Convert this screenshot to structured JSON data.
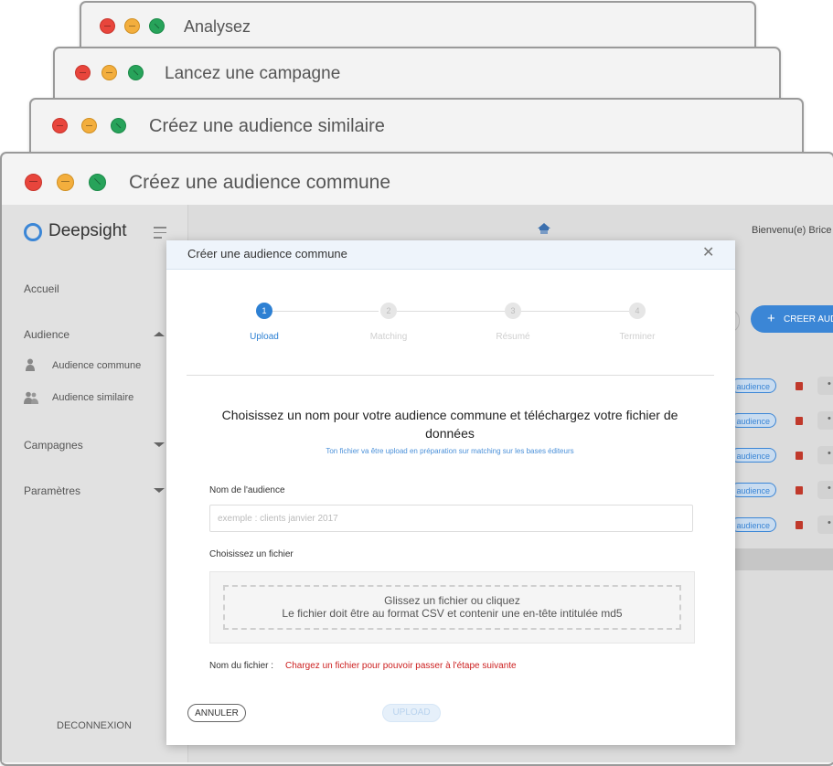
{
  "windows": [
    {
      "title": "Analysez"
    },
    {
      "title": "Lancez une campagne"
    },
    {
      "title": "Créez une audience similaire"
    },
    {
      "title": "Créez une audience commune"
    }
  ],
  "app": {
    "brand": "Deepsight",
    "welcome": "Bienvenu(e) Brice",
    "create_button": "CREER AUDI",
    "row_pill_label": "audience",
    "sidebar": {
      "home": "Accueil",
      "audience": "Audience",
      "audience_commune": "Audience commune",
      "audience_similaire": "Audience similaire",
      "campagnes": "Campagnes",
      "parametres": "Paramètres",
      "logout": "DECONNEXION"
    }
  },
  "modal": {
    "title": "Créer une audience commune",
    "steps": [
      {
        "number": "1",
        "label": "Upload"
      },
      {
        "number": "2",
        "label": "Matching"
      },
      {
        "number": "3",
        "label": "Résumé"
      },
      {
        "number": "4",
        "label": "Terminer"
      }
    ],
    "heading": "Choisissez un nom pour votre audience commune et téléchargez votre fichier de données",
    "subheading": "Ton fichier va être upload en préparation sur matching sur les bases éditeurs",
    "name_label": "Nom de l'audience",
    "name_placeholder": "exemple : clients janvier 2017",
    "file_choose_label": "Choisissez un fichier",
    "dropzone_line1": "Glissez un fichier ou cliquez",
    "dropzone_line2": "Le fichier doit être au format CSV et contenir une en-tête intitulée md5",
    "file_name_label": "Nom du fichier :",
    "file_error": "Chargez un fichier pour pouvoir passer à l'étape suivante",
    "cancel": "ANNULER",
    "upload": "UPLOAD"
  },
  "colors": {
    "accent": "#2d80d3",
    "error": "#cc1f1f"
  }
}
